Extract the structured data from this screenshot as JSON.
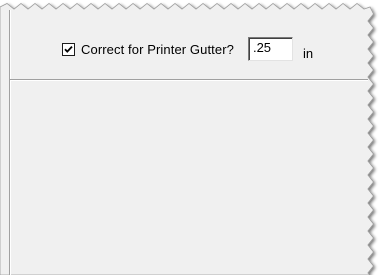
{
  "dialog": {
    "gutter_option": {
      "checkbox_checked": true,
      "label": "Correct for Printer Gutter?",
      "value": ".25",
      "unit": "in"
    }
  },
  "colors": {
    "panel_background": "#f0f0f0",
    "group_border_dark": "#a0a0a0",
    "group_border_light": "#ffffff",
    "torn_edge_shadow": "#8f8f8f"
  }
}
